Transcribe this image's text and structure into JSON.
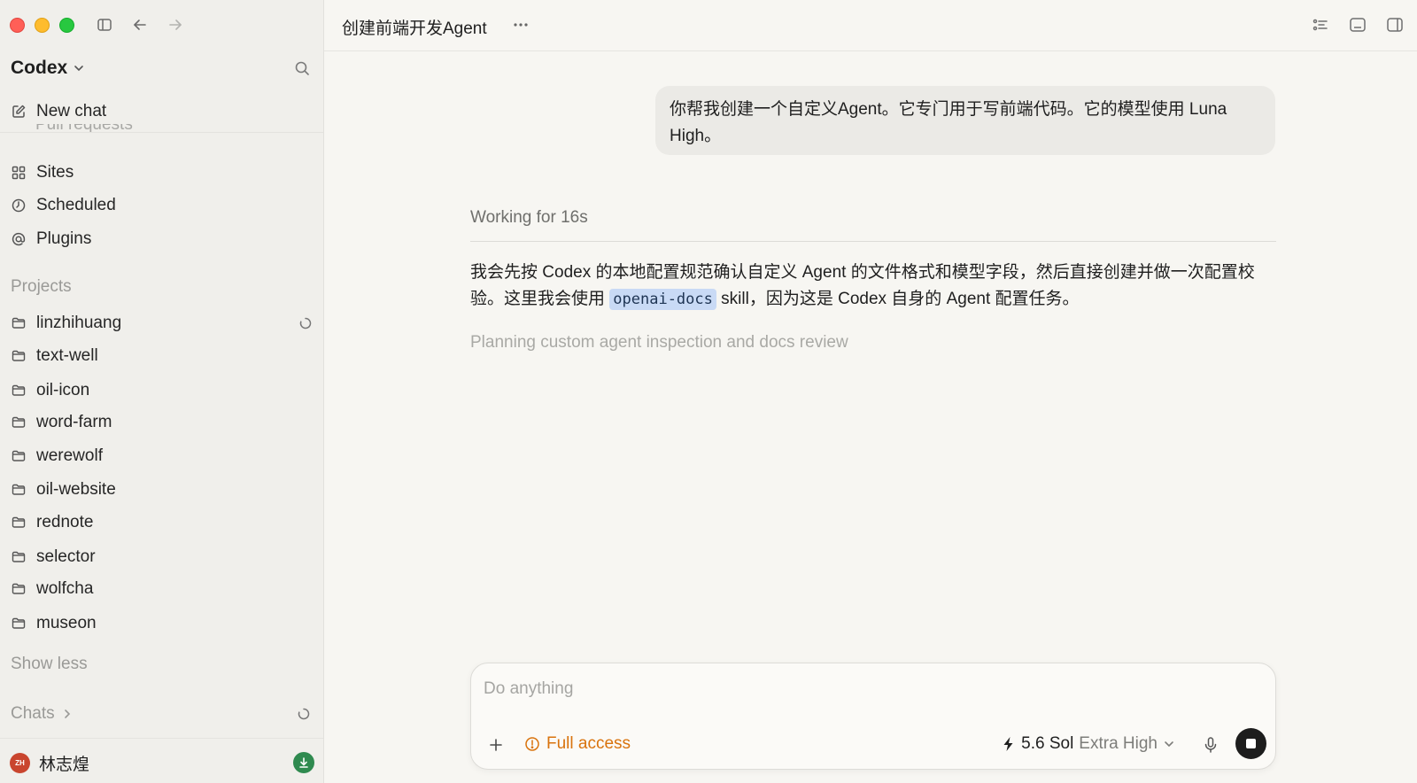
{
  "sidebar": {
    "brand": "Codex",
    "new_chat": "New chat",
    "ghost_item": "Pull requests",
    "nav": [
      {
        "label": "Sites",
        "icon": "grid-icon"
      },
      {
        "label": "Scheduled",
        "icon": "clock-icon"
      },
      {
        "label": "Plugins",
        "icon": "at-icon"
      }
    ],
    "projects_label": "Projects",
    "projects": [
      {
        "label": "linzhihuang",
        "loading": true
      },
      {
        "label": "text-well"
      },
      {
        "label": "oil-icon"
      },
      {
        "label": "word-farm"
      },
      {
        "label": "werewolf"
      },
      {
        "label": "oil-website"
      },
      {
        "label": "rednote"
      },
      {
        "label": "selector"
      },
      {
        "label": "wolfcha"
      },
      {
        "label": "museon"
      }
    ],
    "show_less": "Show less",
    "chats_label": "Chats",
    "user": {
      "initials": "ZH",
      "name": "林志煌"
    }
  },
  "header": {
    "title": "创建前端开发Agent",
    "more": "···"
  },
  "conversation": {
    "user_message": "你帮我创建一个自定义Agent。它专门用于写前端代码。它的模型使用 Luna High。",
    "working": "Working for 16s",
    "response_before": "我会先按 Codex 的本地配置规范确认自定义 Agent 的文件格式和模型字段，然后直接创建并做一次配置校验。这里我会使用 ",
    "response_code": "openai-docs",
    "response_after": " skill，因为这是 Codex 自身的 Agent 配置任务。",
    "planning": "Planning custom agent inspection and docs review"
  },
  "composer": {
    "placeholder": "Do anything",
    "access": "Full access",
    "model": "5.6 Sol",
    "effort": "Extra High"
  },
  "colors": {
    "accent_warning": "#d9730d",
    "code_highlight": "#c9daf5",
    "update_badge": "#2f8a4f"
  }
}
